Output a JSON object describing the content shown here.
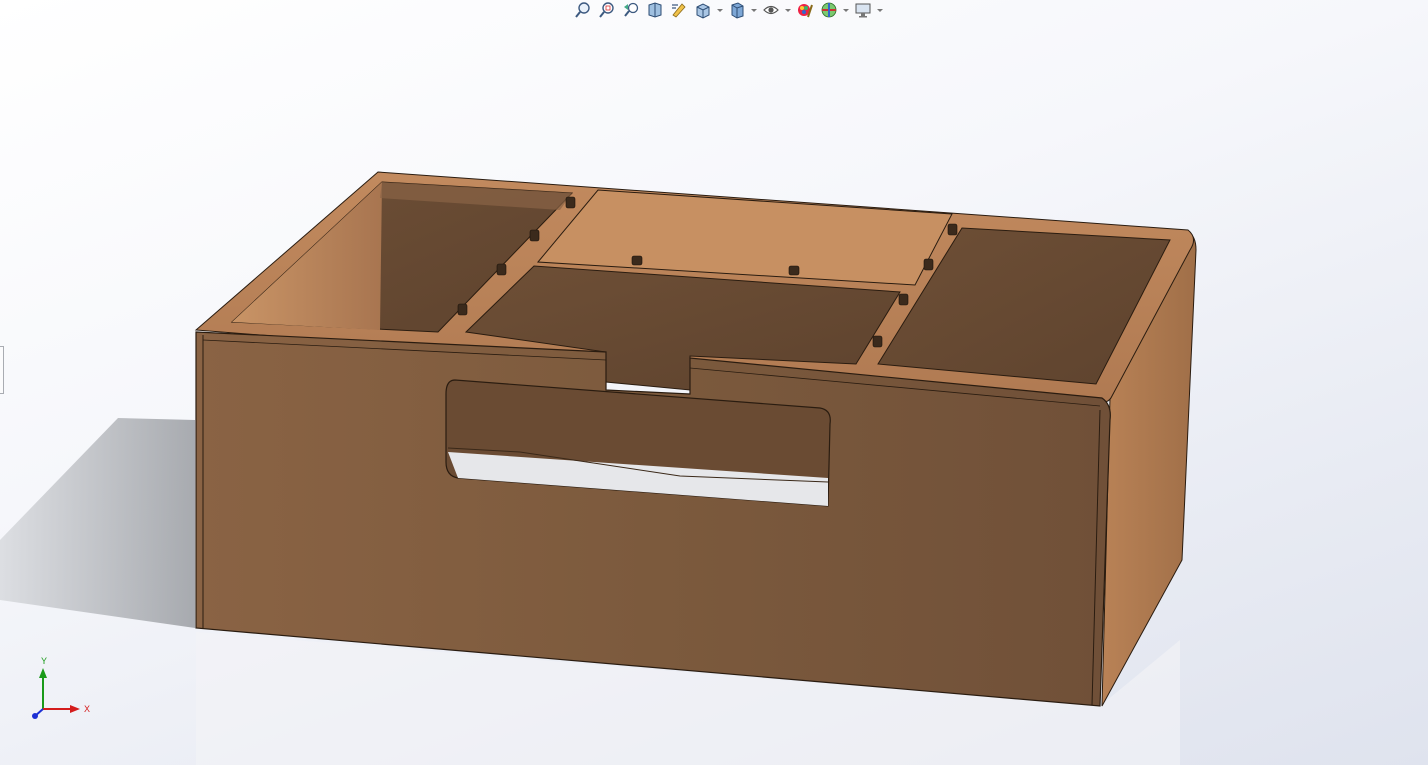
{
  "toolbar": {
    "buttons": [
      {
        "icon": "zoom-to-fit-icon",
        "dropdown": false
      },
      {
        "icon": "zoom-to-area-icon",
        "dropdown": false
      },
      {
        "icon": "previous-view-icon",
        "dropdown": false
      },
      {
        "icon": "section-view-icon",
        "dropdown": false
      },
      {
        "icon": "dynamic-annotation-views-icon",
        "dropdown": false
      },
      {
        "icon": "view-orientation-icon",
        "dropdown": true
      },
      {
        "icon": "display-style-icon",
        "dropdown": true
      },
      {
        "icon": "hide-show-items-icon",
        "dropdown": true
      },
      {
        "icon": "edit-appearance-icon",
        "dropdown": false
      },
      {
        "icon": "apply-scene-icon",
        "dropdown": true
      },
      {
        "icon": "view-settings-icon",
        "dropdown": true
      }
    ]
  },
  "triad": {
    "x_label": "X",
    "y_label": "Y"
  },
  "colors": {
    "wood_front": "#7d5a3c",
    "wood_top": "#b07a52",
    "wood_side": "#9a6a44",
    "axis_x": "#d41c1c",
    "axis_y": "#1a9a1a",
    "axis_z": "#1c2fd4"
  }
}
